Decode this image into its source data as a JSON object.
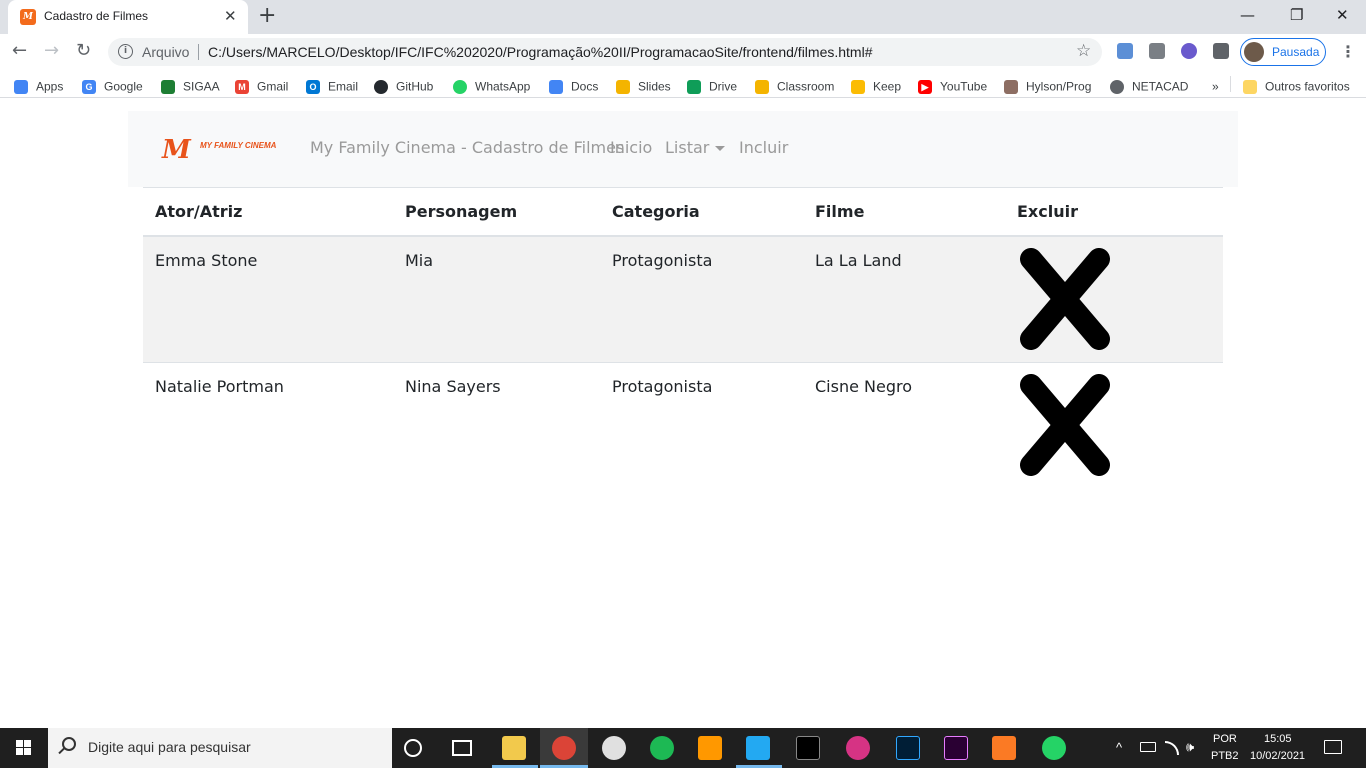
{
  "browser": {
    "tab_title": "Cadastro de Filmes",
    "tab_close": "✕",
    "new_tab": "+",
    "favicon_letter": "M",
    "window_controls": {
      "minimize": "—",
      "restore": "❐",
      "close": "✕"
    },
    "omnibox": {
      "security_label": "Arquivo",
      "url": "C:/Users/MARCELO/Desktop/IFC/IFC%202020/Programação%20II/ProgramacaoSite/frontend/filmes.html#"
    },
    "profile_label": "Pausada",
    "bookmarks": [
      {
        "label": "Apps",
        "icon": "apps-grid-icon",
        "color": "#4285f4"
      },
      {
        "label": "Google",
        "icon": "google-icon",
        "color": "#4285f4"
      },
      {
        "label": "SIGAA",
        "icon": "sigaa-icon",
        "color": "#1e7e34"
      },
      {
        "label": "Gmail",
        "icon": "gmail-icon",
        "color": "#ea4335"
      },
      {
        "label": "Email",
        "icon": "outlook-icon",
        "color": "#0078d4"
      },
      {
        "label": "GitHub",
        "icon": "github-icon",
        "color": "#24292e"
      },
      {
        "label": "WhatsApp",
        "icon": "whatsapp-icon",
        "color": "#25d366"
      },
      {
        "label": "Docs",
        "icon": "docs-icon",
        "color": "#4285f4"
      },
      {
        "label": "Slides",
        "icon": "slides-icon",
        "color": "#f4b400"
      },
      {
        "label": "Drive",
        "icon": "drive-icon",
        "color": "#0f9d58"
      },
      {
        "label": "Classroom",
        "icon": "classroom-icon",
        "color": "#f4b400"
      },
      {
        "label": "Keep",
        "icon": "keep-icon",
        "color": "#fbbc04"
      },
      {
        "label": "YouTube",
        "icon": "youtube-icon",
        "color": "#ff0000"
      },
      {
        "label": "Hylson/Prog",
        "icon": "profile-photo-icon",
        "color": "#8d6e63"
      },
      {
        "label": "NETACAD",
        "icon": "netacad-icon",
        "color": "#5f6368"
      }
    ],
    "bookmarks_overflow": "»",
    "other_bookmarks": "Outros favoritos"
  },
  "site": {
    "brand_letter": "M",
    "brand_name": "MY FAMILY CINEMA",
    "nav_title": "My Family Cinema - Cadastro de Filmes",
    "nav_home": "Inicio",
    "nav_list": "Listar",
    "nav_add": "Incluir"
  },
  "table": {
    "headers": [
      "Ator/Atriz",
      "Personagem",
      "Categoria",
      "Filme",
      "Excluir"
    ],
    "rows": [
      [
        "Emma Stone",
        "Mia",
        "Protagonista",
        "La La Land"
      ],
      [
        "Natalie Portman",
        "Nina Sayers",
        "Protagonista",
        "Cisne Negro"
      ]
    ]
  },
  "taskbar": {
    "search_placeholder": "Digite aqui para pesquisar",
    "lang_top": "POR",
    "lang_bottom": "PTB2",
    "time": "15:05",
    "date": "10/02/2021"
  },
  "colors": {
    "brand_orange": "#e8531b",
    "chrome_tabstrip": "#dee1e6",
    "navbar_bg": "#f8f9fa",
    "striped_row": "#f2f2f2",
    "taskbar": "#1f1f1f"
  }
}
